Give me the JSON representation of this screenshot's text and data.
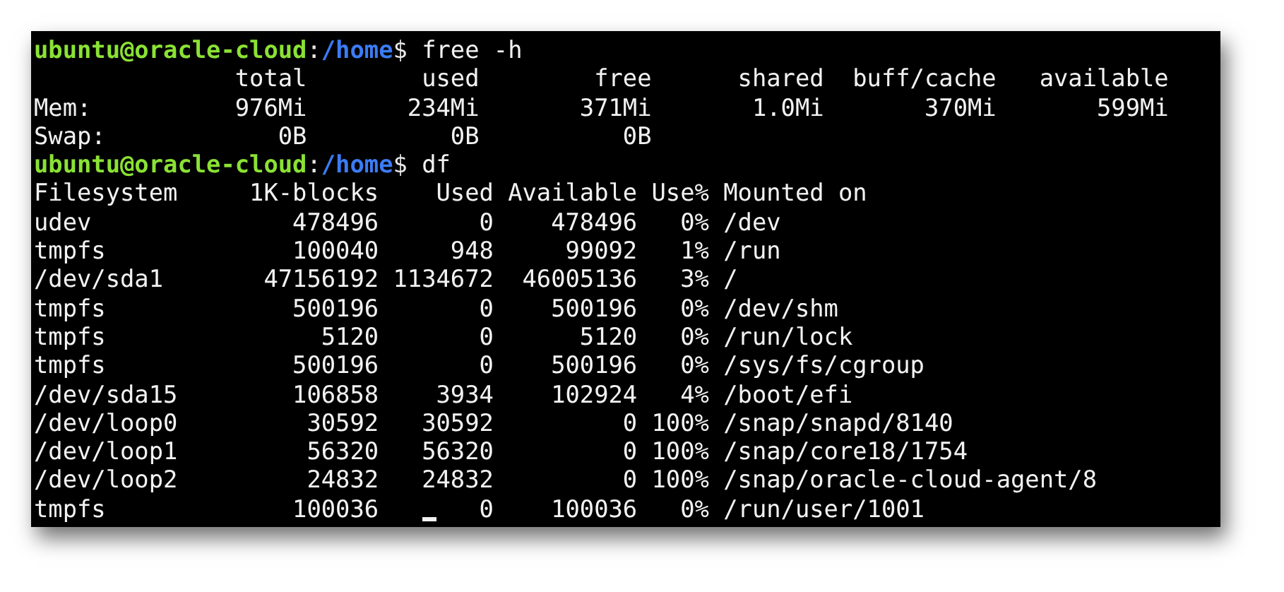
{
  "terminal": {
    "lines": [
      {
        "kind": "prompt",
        "user_host": "ubuntu@oracle-cloud",
        "separator": ":",
        "path": "/home",
        "symbol": "$",
        "command": "free -h"
      },
      {
        "kind": "output",
        "text": "              total        used        free      shared  buff/cache   available"
      },
      {
        "kind": "output",
        "text": "Mem:          976Mi       234Mi       371Mi       1.0Mi       370Mi       599Mi"
      },
      {
        "kind": "output",
        "text": "Swap:            0B          0B          0B"
      },
      {
        "kind": "prompt",
        "user_host": "ubuntu@oracle-cloud",
        "separator": ":",
        "path": "/home",
        "symbol": "$",
        "command": "df"
      },
      {
        "kind": "output",
        "text": "Filesystem     1K-blocks    Used Available Use% Mounted on"
      },
      {
        "kind": "output",
        "text": "udev              478496       0    478496   0% /dev"
      },
      {
        "kind": "output",
        "text": "tmpfs             100040     948     99092   1% /run"
      },
      {
        "kind": "output",
        "text": "/dev/sda1       47156192 1134672  46005136   3% /"
      },
      {
        "kind": "output",
        "text": "tmpfs             500196       0    500196   0% /dev/shm"
      },
      {
        "kind": "output",
        "text": "tmpfs               5120       0      5120   0% /run/lock"
      },
      {
        "kind": "output",
        "text": "tmpfs             500196       0    500196   0% /sys/fs/cgroup"
      },
      {
        "kind": "output",
        "text": "/dev/sda15        106858    3934    102924   4% /boot/efi"
      },
      {
        "kind": "output",
        "text": "/dev/loop0         30592   30592         0 100% /snap/snapd/8140"
      },
      {
        "kind": "output",
        "text": "/dev/loop1         56320   56320         0 100% /snap/core18/1754"
      },
      {
        "kind": "output",
        "text": "/dev/loop2         24832   24832         0 100% /snap/oracle-cloud-agent/8"
      },
      {
        "kind": "output",
        "text": "tmpfs             100036   ",
        "text_after_cursor": "   0    100036   0% /run/user/1001"
      }
    ]
  }
}
